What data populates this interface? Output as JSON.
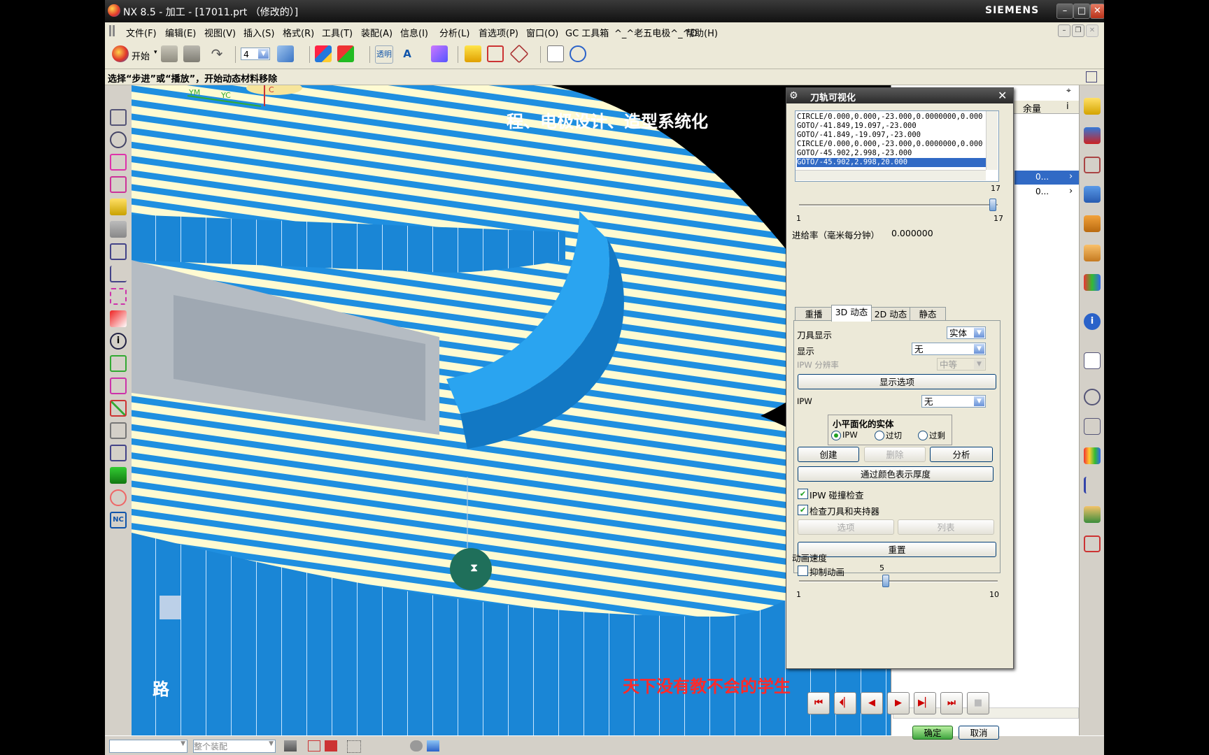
{
  "window": {
    "title": "NX 8.5 - 加工 - [17011.prt （修改的）]",
    "brand": "SIEMENS"
  },
  "menu": [
    "文件(F)",
    "编辑(E)",
    "视图(V)",
    "插入(S)",
    "格式(R)",
    "工具(T)",
    "装配(A)",
    "信息(I)",
    "分析(L)",
    "首选项(P)",
    "窗口(O)",
    "GC 工具箱",
    "^_^老五电极^_^D",
    "帮助(H)"
  ],
  "toolbar": {
    "start_label": "开始",
    "layer_value": "4",
    "transparent_label": "透明"
  },
  "cue_line": "选择“步进”或“播放”，开始动态材料移除",
  "viewport": {
    "axis_labels": [
      "YM",
      "YC",
      "C"
    ],
    "subtitle_top": "程、电极设计、造型系统化",
    "subtitle_bottom_left": "路",
    "subtitle_bottom_right": "天下没有教不会的学生"
  },
  "right_panel": {
    "headers": [
      "余量",
      "i"
    ],
    "row_values": [
      "0...",
      "0..."
    ]
  },
  "dialog": {
    "title": "刀轨可视化",
    "toolpath_lines": [
      "CIRCLE/0.000,0.000,-23.000,0.0000000,0.000",
      "GOTO/-41.849,19.097,-23.000",
      "GOTO/-41.849,-19.097,-23.000",
      "CIRCLE/0.000,0.000,-23.000,0.0000000,0.000",
      "GOTO/-45.902,2.998,-23.000",
      "GOTO/-45.902,2.998,20.000"
    ],
    "selected_index": 5,
    "slider_top": {
      "value": "17",
      "min": "1",
      "max": "17",
      "fraction": 1.0
    },
    "feed_label": "进给率（毫米每分钟）",
    "feed_value": "0.000000",
    "tabs": [
      "重播",
      "3D 动态",
      "2D 动态",
      "静态"
    ],
    "active_tab": 1,
    "tool_display_label": "刀具显示",
    "tool_display_value": "实体",
    "display_label": "显示",
    "display_value": "无",
    "ipw_res_label": "IPW 分辨率",
    "ipw_res_value": "中等",
    "display_options_btn": "显示选项",
    "ipw_label": "IPW",
    "ipw_value": "无",
    "facet_group_title": "小平面化的实体",
    "facet_options": [
      "IPW",
      "过切",
      "过剩"
    ],
    "facet_selected": 0,
    "create_btn": "创建",
    "delete_btn": "删除",
    "analyze_btn": "分析",
    "thickness_btn": "通过颜色表示厚度",
    "ipw_collision_label": "IPW 碰撞检查",
    "ipw_collision_checked": true,
    "check_holder_label": "检查刀具和夹持器",
    "check_holder_checked": true,
    "options_btn": "选项",
    "list_btn": "列表",
    "reset_btn": "重置",
    "suppress_anim_label": "抑制动画",
    "suppress_anim_checked": false,
    "anim_speed_label": "动画速度",
    "anim_slider": {
      "value": "5",
      "min": "1",
      "max": "10",
      "fraction": 0.444
    },
    "ok_btn": "确定",
    "cancel_btn": "取消"
  },
  "status_bar": {
    "filter_value": "",
    "assembly_value": "整个装配"
  },
  "colors": {
    "part_blue": "#1f8fe0",
    "part_cream": "#fffbd2",
    "subtitle_red": "#ff2a2a"
  }
}
